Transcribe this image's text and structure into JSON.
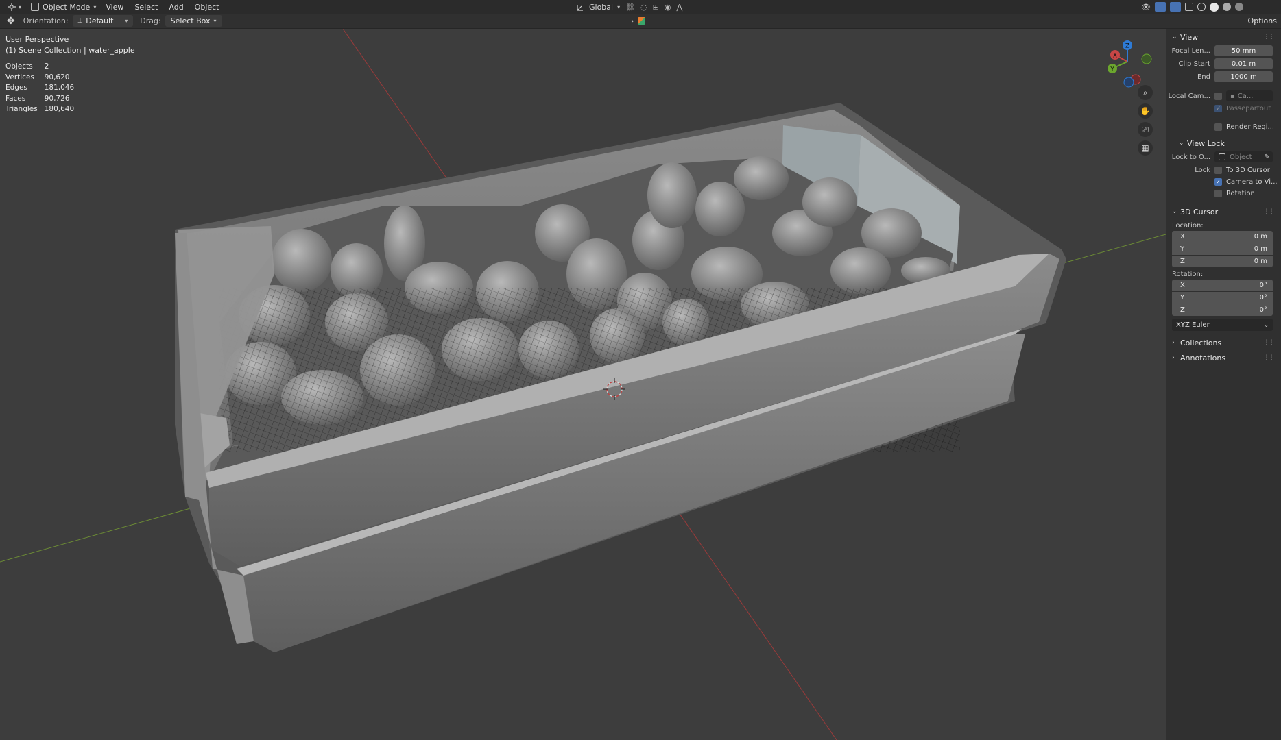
{
  "topbar": {
    "mode_label": "Object Mode",
    "menus": [
      "View",
      "Select",
      "Add",
      "Object"
    ],
    "transform_orientation": "Global"
  },
  "toolbar": {
    "orientation_label": "Orientation:",
    "orientation_value": "Default",
    "drag_label": "Drag:",
    "drag_value": "Select Box",
    "options_label": "Options"
  },
  "viewport": {
    "perspective": "User Perspective",
    "collection": "(1) Scene Collection | water_apple",
    "stats": [
      {
        "label": "Objects",
        "value": "2"
      },
      {
        "label": "Vertices",
        "value": "90,620"
      },
      {
        "label": "Edges",
        "value": "181,046"
      },
      {
        "label": "Faces",
        "value": "90,726"
      },
      {
        "label": "Triangles",
        "value": "180,640"
      }
    ],
    "gizmo": {
      "x": "X",
      "y": "Y",
      "z": "Z"
    }
  },
  "sidebar": {
    "view": {
      "title": "View",
      "focal_label": "Focal Len...",
      "focal_value": "50 mm",
      "clip_start_label": "Clip Start",
      "clip_start_value": "0.01 m",
      "end_label": "End",
      "end_value": "1000 m",
      "local_cam_label": "Local Cam...",
      "local_cam_value": "Ca...",
      "passepartout": "Passepartout",
      "render_region": "Render Regi..."
    },
    "view_lock": {
      "title": "View Lock",
      "lock_to_label": "Lock to O...",
      "lock_to_placeholder": "Object",
      "lock_label": "Lock",
      "to_3d_cursor": "To 3D Cursor",
      "camera_to_view": "Camera to Vi...",
      "rotation": "Rotation"
    },
    "cursor": {
      "title": "3D Cursor",
      "location_label": "Location:",
      "location": [
        {
          "axis": "X",
          "value": "0 m"
        },
        {
          "axis": "Y",
          "value": "0 m"
        },
        {
          "axis": "Z",
          "value": "0 m"
        }
      ],
      "rotation_label": "Rotation:",
      "rotation": [
        {
          "axis": "X",
          "value": "0°"
        },
        {
          "axis": "Y",
          "value": "0°"
        },
        {
          "axis": "Z",
          "value": "0°"
        }
      ],
      "rotation_mode": "XYZ Euler"
    },
    "collections": "Collections",
    "annotations": "Annotations"
  }
}
